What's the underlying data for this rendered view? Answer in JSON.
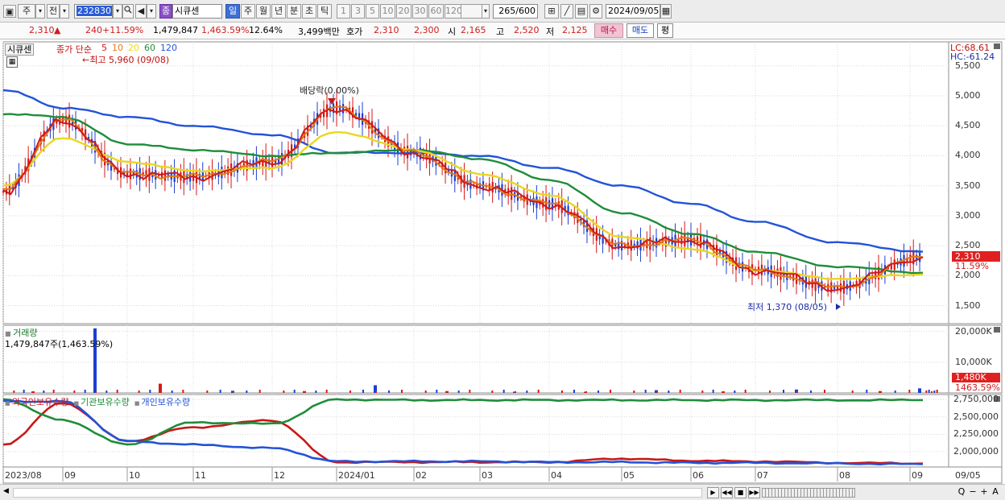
{
  "toolbar": {
    "market_type": "주",
    "prefix": "전",
    "code": "232830",
    "type_badge": "종",
    "name": "시큐센",
    "periods": [
      "일",
      "주",
      "월",
      "년",
      "분",
      "초",
      "틱"
    ],
    "intervals": [
      "1",
      "3",
      "5",
      "10",
      "20",
      "30",
      "60",
      "120"
    ],
    "count_value": "265",
    "count_total": "/600",
    "date": "2024/09/05"
  },
  "quote": {
    "price": "2,310",
    "arrow": "▲",
    "change": "240",
    "change_pct": "+11.59%",
    "volume": "1,479,847",
    "volume_pct": "1,463.59%",
    "turnover_pct": "12.64%",
    "amount": "3,499백만",
    "ask_label": "호가",
    "ask1": "2,310",
    "ask2": "2,300",
    "open_label": "시",
    "open": "2,165",
    "high_label": "고",
    "high": "2,520",
    "low_label": "저",
    "low": "2,125",
    "buy_label": "매수",
    "sell_label": "매도",
    "eval_label": "평"
  },
  "price_panel": {
    "stock_tag": "시큐센",
    "ma_title": "종가 단순",
    "ma_periods": [
      "5",
      "10",
      "20",
      "60",
      "120"
    ],
    "ma_colors": [
      "#cc1b1b",
      "#e07b16",
      "#e8d820",
      "#1f8d3a",
      "#2253d8"
    ],
    "max_note": "←최고 5,960 (09/08)",
    "div_note": "배당락(0.00%)",
    "min_note": "최저 1,370 (08/05)",
    "lc": "LC:68.61",
    "hc": "HC:-61.24",
    "price_tag": "2,310",
    "pct_tag": "11.59%",
    "y_ticks": [
      "5,500",
      "5,000",
      "4,500",
      "4,000",
      "3,500",
      "3,000",
      "2,500",
      "2,000",
      "1,500"
    ]
  },
  "volume_panel": {
    "title": "거래량",
    "value_note": "1,479,847주(1,463.59%)",
    "y_ticks": [
      "20,000K",
      "10,000K"
    ],
    "tag_value": "1,480K",
    "tag_pct": "1463.59%"
  },
  "holding_panel": {
    "series": [
      "외국인보유수량",
      "기관보유수량",
      "개인보유수량"
    ],
    "y_ticks": [
      "2,750,000",
      "2,500,000",
      "2,250,000",
      "2,000,000"
    ]
  },
  "x_axis": {
    "labels": [
      "2023/08",
      "09",
      "10",
      "11",
      "12",
      "2024/01",
      "02",
      "03",
      "04",
      "05",
      "06",
      "07",
      "08",
      "09"
    ],
    "right_label": "09/05"
  },
  "scroll_controls": [
    "▶",
    "◀◀",
    "■",
    "▶▶"
  ],
  "zoom_controls": [
    "Q",
    "−",
    "+",
    "A"
  ],
  "chart_data": [
    {
      "type": "line",
      "title": "시큐센 종가 단순 이동평균",
      "x": [
        "2023/08",
        "09",
        "10",
        "11",
        "12",
        "2024/01",
        "02",
        "03",
        "04",
        "05",
        "06",
        "07",
        "08",
        "09/05"
      ],
      "series": [
        {
          "name": "종가",
          "values": [
            3400,
            4600,
            3700,
            3650,
            3900,
            4800,
            4050,
            3500,
            3200,
            2500,
            2600,
            2100,
            1800,
            2310
          ]
        },
        {
          "name": "120",
          "values": [
            5100,
            4800,
            4650,
            4500,
            4350,
            4050,
            4050,
            4000,
            3800,
            3500,
            3200,
            2900,
            2550,
            2400
          ]
        },
        {
          "name": "60",
          "values": [
            4700,
            4650,
            4200,
            4100,
            4000,
            4050,
            4100,
            3950,
            3600,
            3050,
            2700,
            2400,
            2150,
            2050
          ]
        },
        {
          "name": "20",
          "values": [
            3500,
            4300,
            3900,
            3750,
            3800,
            4400,
            4100,
            3700,
            3350,
            2650,
            2450,
            2100,
            1950,
            2020
          ]
        }
      ],
      "ylim": [
        1200,
        5900
      ],
      "xlabel": "",
      "ylabel": ""
    },
    {
      "type": "bar",
      "title": "거래량",
      "categories": [
        "2023/08",
        "09",
        "10",
        "11",
        "12",
        "2024/01",
        "02",
        "03",
        "04",
        "05",
        "06",
        "07",
        "08",
        "09/05"
      ],
      "values": [
        500,
        21000,
        3000,
        700,
        600,
        2500,
        600,
        400,
        400,
        900,
        500,
        1100,
        600,
        1480
      ],
      "ylim": [
        0,
        22000
      ]
    },
    {
      "type": "line",
      "title": "보유수량",
      "x": [
        "2023/08",
        "09",
        "10",
        "11",
        "12",
        "2024/01",
        "02",
        "03",
        "04",
        "05",
        "06",
        "07",
        "08",
        "09/05"
      ],
      "series": [
        {
          "name": "외국인보유수량",
          "values": [
            2100000,
            2700000,
            2150000,
            2350000,
            2450000,
            1850000,
            1850000,
            1850000,
            1850000,
            1900000,
            1870000,
            1860000,
            1840000,
            1830000
          ]
        },
        {
          "name": "기관보유수량",
          "values": [
            2750000,
            2450000,
            2100000,
            2420000,
            2400000,
            2750000,
            2740000,
            2740000,
            2740000,
            2740000,
            2740000,
            2740000,
            2740000,
            2740000
          ]
        },
        {
          "name": "개인보유수량",
          "values": [
            2720000,
            2720000,
            2150000,
            2100000,
            2050000,
            1860000,
            1860000,
            1860000,
            1850000,
            1850000,
            1840000,
            1840000,
            1830000,
            1820000
          ]
        }
      ],
      "ylim": [
        1780000,
        2820000
      ]
    }
  ]
}
